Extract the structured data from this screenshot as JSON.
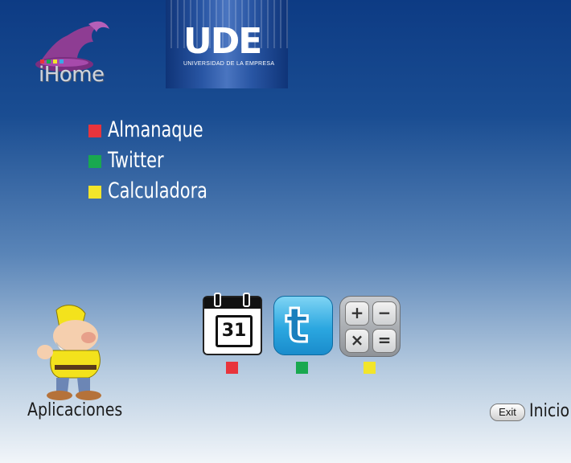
{
  "header": {
    "brand_logo": {
      "text": "iHome",
      "dot_colors": [
        "#e8343c",
        "#19a84f",
        "#f2e52a",
        "#3ba7e6"
      ]
    },
    "university_logo": {
      "text": "UDE",
      "subtitle": "UNIVERSIDAD DE LA EMPRESA"
    }
  },
  "menu": {
    "items": [
      {
        "label": "Almanaque",
        "color": "#e8343c"
      },
      {
        "label": "Twitter",
        "color": "#19a84f"
      },
      {
        "label": "Calculadora",
        "color": "#f2e52a"
      }
    ]
  },
  "apps": [
    {
      "icon": "calendar-icon",
      "text": "31",
      "color": "#e8343c"
    },
    {
      "icon": "twitter-icon",
      "text": "t",
      "color": "#19a84f"
    },
    {
      "icon": "calculator-icon",
      "keys": [
        "+",
        "−",
        "×",
        "="
      ],
      "color": "#f2e52a"
    }
  ],
  "footer": {
    "apps_label": "Aplicaciones",
    "exit_label": "Exit",
    "home_label": "Inicio"
  }
}
